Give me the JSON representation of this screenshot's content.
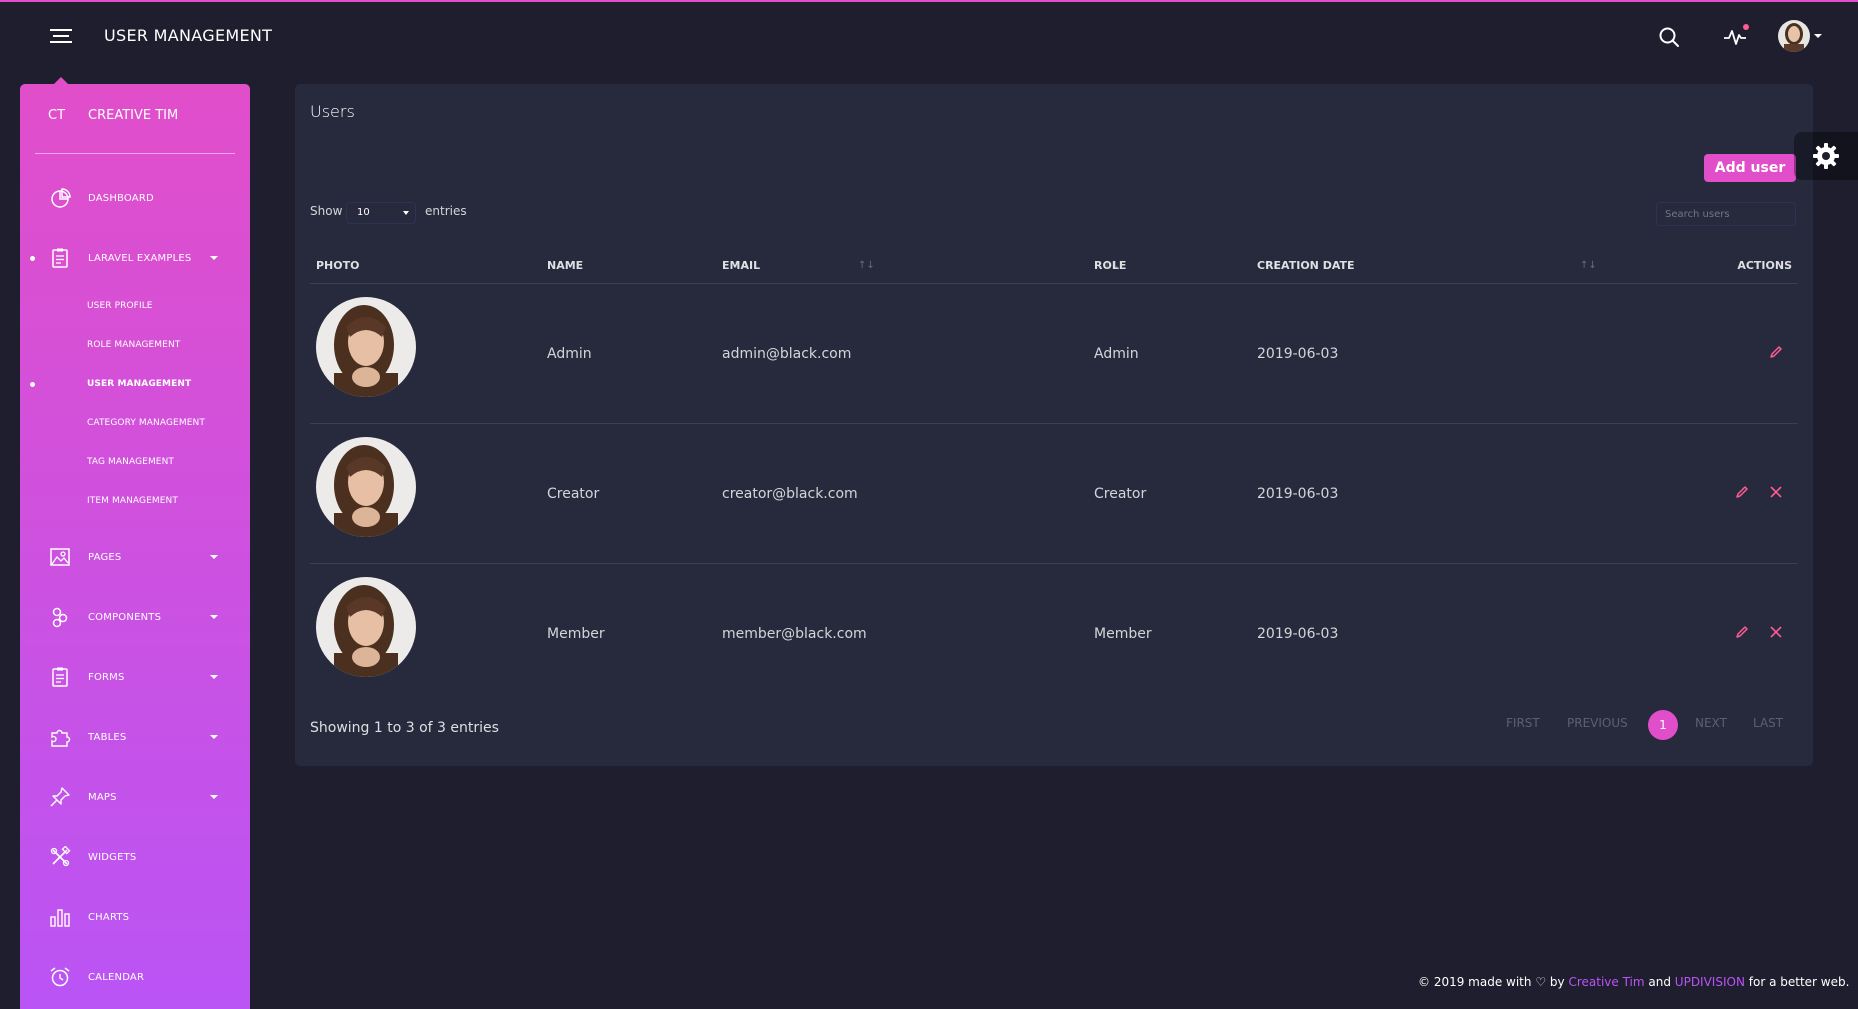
{
  "navbar": {
    "title": "USER MANAGEMENT"
  },
  "sidebar": {
    "brand_mini": "CT",
    "brand_full": "CREATIVE TIM",
    "items": [
      {
        "label": "DASHBOARD",
        "icon": "chart-pie-icon"
      },
      {
        "label": "LARAVEL EXAMPLES",
        "icon": "clipboard-icon"
      },
      {
        "label": "PAGES",
        "icon": "image-icon"
      },
      {
        "label": "COMPONENTS",
        "icon": "components-icon"
      },
      {
        "label": "FORMS",
        "icon": "notes-icon"
      },
      {
        "label": "TABLES",
        "icon": "puzzle-icon"
      },
      {
        "label": "MAPS",
        "icon": "pin-icon"
      },
      {
        "label": "WIDGETS",
        "icon": "settings-tools-icon"
      },
      {
        "label": "CHARTS",
        "icon": "bar-chart-icon"
      },
      {
        "label": "CALENDAR",
        "icon": "alarm-clock-icon"
      }
    ],
    "subitems": [
      "USER PROFILE",
      "ROLE MANAGEMENT",
      "USER MANAGEMENT",
      "CATEGORY MANAGEMENT",
      "TAG MANAGEMENT",
      "ITEM MANAGEMENT"
    ]
  },
  "card": {
    "title": "Users",
    "add_button": "Add user",
    "show_label": "Show",
    "show_value": "10",
    "entries_label": "entries",
    "search_placeholder": "Search users"
  },
  "table": {
    "headers": [
      "PHOTO",
      "NAME",
      "EMAIL",
      "ROLE",
      "CREATION DATE",
      "ACTIONS"
    ],
    "rows": [
      {
        "name": "Admin",
        "email": "admin@black.com",
        "role": "Admin",
        "date": "2019-06-03"
      },
      {
        "name": "Creator",
        "email": "creator@black.com",
        "role": "Creator",
        "date": "2019-06-03"
      },
      {
        "name": "Member",
        "email": "member@black.com",
        "role": "Member",
        "date": "2019-06-03"
      }
    ]
  },
  "pagination": {
    "showing": "Showing 1 to 3 of 3 entries",
    "first": "FIRST",
    "previous": "PREVIOUS",
    "current": "1",
    "next": "NEXT",
    "last": "LAST"
  },
  "footer": {
    "prefix": "© 2019 made with",
    "by": "by",
    "link1": "Creative Tim",
    "and": "and",
    "link2": "UPDIVISION",
    "suffix": "for a better web."
  },
  "colors": {
    "accent": "#e14eca",
    "accent2": "#ba54f5",
    "background": "#1e1e2f",
    "card": "#27293d",
    "danger": "#fd5d93"
  }
}
